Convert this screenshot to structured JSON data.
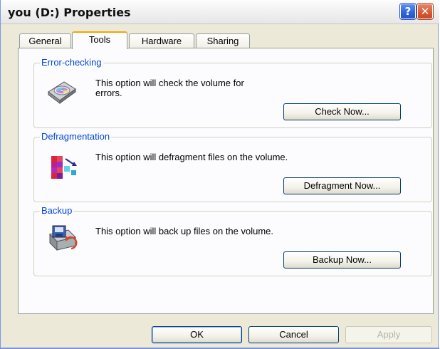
{
  "window": {
    "title": "you (D:) Properties"
  },
  "titlebar_buttons": {
    "help_glyph": "?",
    "close_glyph": "✕"
  },
  "tabs": [
    {
      "label": "General"
    },
    {
      "label": "Tools",
      "active": true
    },
    {
      "label": "Hardware"
    },
    {
      "label": "Sharing"
    }
  ],
  "groups": {
    "error_checking": {
      "title": "Error-checking",
      "text_line1": "This option will check the volume for",
      "text_line2": "errors.",
      "button": "Check Now...",
      "icon": "disk-check-icon"
    },
    "defragmentation": {
      "title": "Defragmentation",
      "text": "This option will defragment files on the volume.",
      "button": "Defragment Now...",
      "icon": "defragment-icon"
    },
    "backup": {
      "title": "Backup",
      "text": "This option will back up files on the volume.",
      "button": "Backup Now...",
      "icon": "backup-icon"
    }
  },
  "footer": {
    "ok": "OK",
    "cancel": "Cancel",
    "apply": "Apply"
  },
  "colors": {
    "window_bg": "#ECE9D8",
    "group_title": "#0046d5",
    "tab_highlight": "#f0a800",
    "close_button": "#d55a33",
    "help_button": "#2f63de"
  }
}
